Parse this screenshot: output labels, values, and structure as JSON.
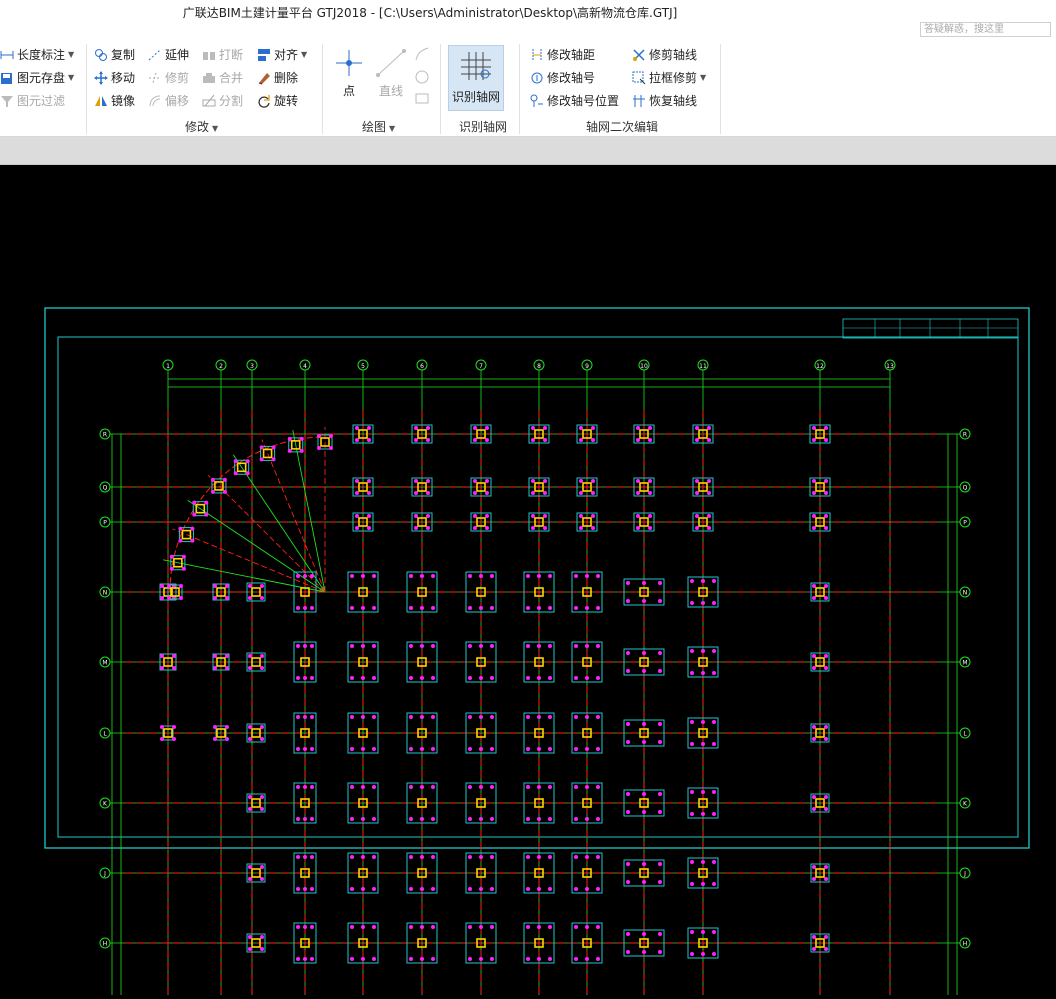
{
  "window": {
    "title": "广联达BIM土建计量平台 GTJ2018 - [C:\\Users\\Administrator\\Desktop\\高新物流仓库.GTJ]",
    "search_placeholder": "答疑解惑，搜这里"
  },
  "ribbon": {
    "left_group": {
      "length_dim": "长度标注",
      "element_save": "图元存盘",
      "element_filter": "图元过滤"
    },
    "modify": {
      "label": "修改",
      "copy": "复制",
      "extend": "延伸",
      "break": "打断",
      "align": "对齐",
      "move": "移动",
      "trim": "修剪",
      "merge": "合并",
      "delete": "删除",
      "mirror": "镜像",
      "offset": "偏移",
      "split": "分割",
      "rotate": "旋转"
    },
    "draw": {
      "label": "绘图",
      "point": "点",
      "line": "直线"
    },
    "identify": {
      "label": "识别轴网",
      "button": "识别轴网"
    },
    "axis_edit": {
      "label": "轴网二次编辑",
      "modify_spacing": "修改轴距",
      "modify_label": "修改轴号",
      "modify_label_pos": "修改轴号位置",
      "trim_axis": "修剪轴线",
      "box_trim": "拉框修剪",
      "restore_axis": "恢复轴线"
    }
  },
  "drawing": {
    "top_axes": [
      "1",
      "2",
      "3",
      "4",
      "5",
      "6",
      "7",
      "8",
      "9",
      "10",
      "11",
      "12",
      "13"
    ],
    "side_axes": [
      "R",
      "Q",
      "P",
      "N",
      "M",
      "L",
      "K",
      "J",
      "H",
      "G"
    ],
    "colors": {
      "grid": "#ff2020",
      "dim": "#20e020",
      "frame": "#20c8c8",
      "column": "#ffd400",
      "pile": "#ff20ff",
      "label": "#ffffff"
    }
  }
}
